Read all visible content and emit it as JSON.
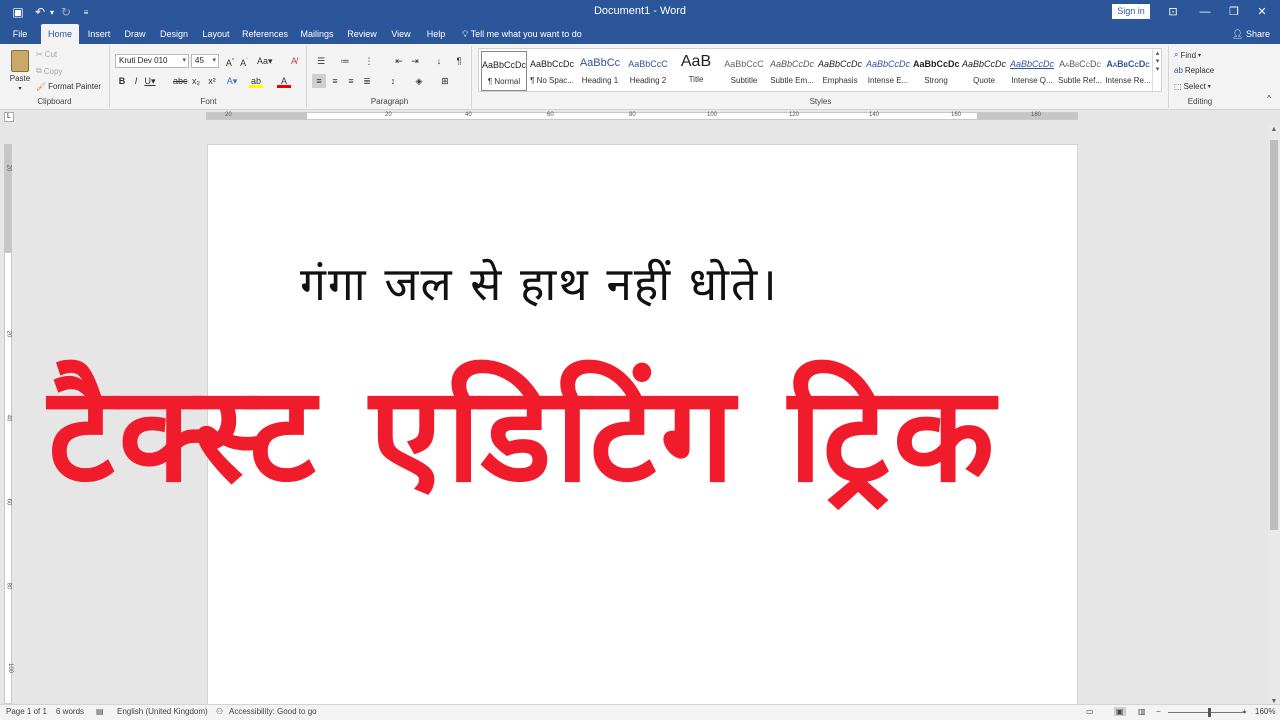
{
  "titlebar": {
    "doc_title": "Document1 - Word",
    "signin_label": "Sign in",
    "accent": "#2b579a"
  },
  "tabs": [
    {
      "label": "File"
    },
    {
      "label": "Home"
    },
    {
      "label": "Insert"
    },
    {
      "label": "Draw"
    },
    {
      "label": "Design"
    },
    {
      "label": "Layout"
    },
    {
      "label": "References"
    },
    {
      "label": "Mailings"
    },
    {
      "label": "Review"
    },
    {
      "label": "View"
    },
    {
      "label": "Help"
    }
  ],
  "tellme_label": "Tell me what you want to do",
  "share_label": "Share",
  "clipboard": {
    "paste": "Paste",
    "cut": "Cut",
    "copy": "Copy",
    "format_painter": "Format Painter",
    "group_label": "Clipboard"
  },
  "font": {
    "font_name": "Kruti Dev 010",
    "font_size": "45",
    "group_label": "Font"
  },
  "paragraph": {
    "group_label": "Paragraph"
  },
  "styles": {
    "group_label": "Styles",
    "items": [
      {
        "preview": "AaBbCcDc",
        "name": "¶ Normal"
      },
      {
        "preview": "AaBbCcDc",
        "name": "¶ No Spac..."
      },
      {
        "preview": "AaBbCc",
        "name": "Heading 1"
      },
      {
        "preview": "AaBbCcC",
        "name": "Heading 2"
      },
      {
        "preview": "AaB",
        "name": "Title"
      },
      {
        "preview": "AaBbCcC",
        "name": "Subtitle"
      },
      {
        "preview": "AaBbCcDc",
        "name": "Subtle Em..."
      },
      {
        "preview": "AaBbCcDc",
        "name": "Emphasis"
      },
      {
        "preview": "AaBbCcDc",
        "name": "Intense E..."
      },
      {
        "preview": "AaBbCcDc",
        "name": "Strong"
      },
      {
        "preview": "AaBbCcDc",
        "name": "Quote"
      },
      {
        "preview": "AaBbCcDc",
        "name": "Intense Q..."
      },
      {
        "preview": "AaBbCcDc",
        "name": "Subtle Ref..."
      },
      {
        "preview": "AaBbCcDc",
        "name": "Intense Re..."
      }
    ]
  },
  "editing": {
    "find": "Find",
    "replace": "Replace",
    "select": "Select",
    "group_label": "Editing"
  },
  "ruler": {
    "h_numbers": [
      "20",
      "20",
      "40",
      "60",
      "80",
      "100",
      "120",
      "140",
      "160",
      "180"
    ],
    "v_numbers": [
      "20",
      "20",
      "40",
      "60",
      "80",
      "100"
    ]
  },
  "document": {
    "line1": "गंगा जल से हाथ नहीं धोते।",
    "line2": "टैक्स्ट एडिटिंग ट्रिक",
    "line2_color": "#f01c2c"
  },
  "status": {
    "page": "Page 1 of 1",
    "words": "6 words",
    "language": "English (United Kingdom)",
    "accessibility": "Accessibility: Good to go",
    "zoom": "160%"
  }
}
